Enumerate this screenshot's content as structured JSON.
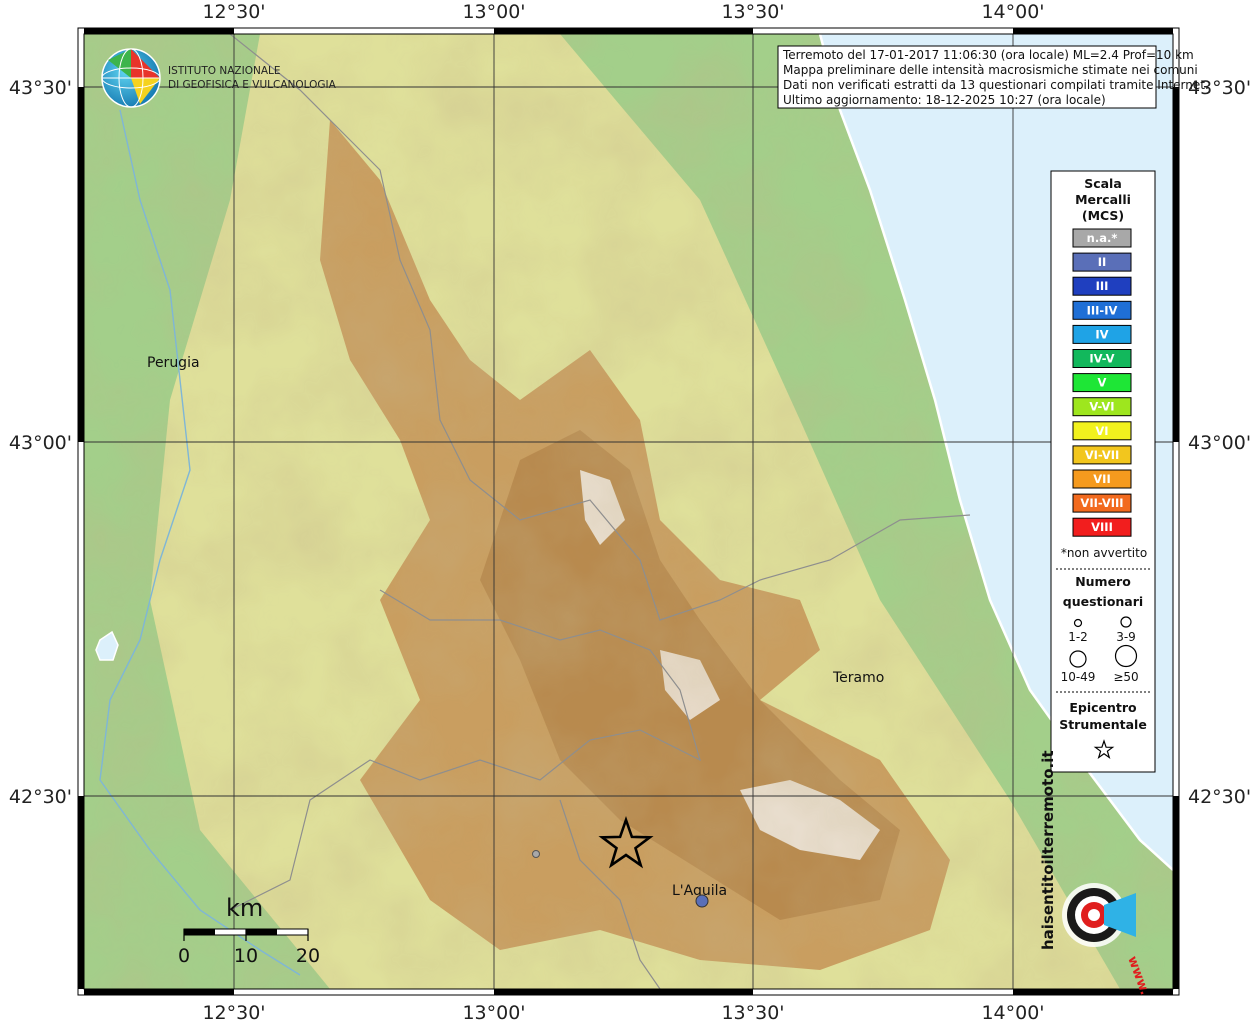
{
  "map": {
    "lon_ticks": [
      "12°30'",
      "13°00'",
      "13°30'",
      "14°00'"
    ],
    "lat_ticks": [
      "43°30'",
      "43°00'",
      "42°30'"
    ],
    "colors": {
      "sea": "#dcf0fb",
      "lowland": "#9fd08a",
      "hill": "#e6e098",
      "mountain": "#c79a5c",
      "peak": "#f4f0ec"
    }
  },
  "logo": {
    "line1": "ISTITUTO NAZIONALE",
    "line2": "DI GEOFISICA E VULCANOLOGIA",
    "icon": "ingv-globe-icon"
  },
  "info": {
    "lines": [
      "Terremoto del 17-01-2017 11:06:30 (ora locale) ML=2.4 Prof=10 km",
      "Mappa preliminare delle intensità macrosismiche stimate nei comuni",
      "Dati non verificati estratti da 13 questionari compilati tramite Internet.",
      "Ultimo aggiornamento: 18-12-2025 10:27 (ora locale)"
    ]
  },
  "cities": {
    "perugia": "Perugia",
    "teramo": "Teramo",
    "laquila": "L'Aquila"
  },
  "legend": {
    "title1": "Scala",
    "title2": "Mercalli",
    "title3": "(MCS)",
    "classes": [
      {
        "label": "n.a.*",
        "color": "#a8a8a8"
      },
      {
        "label": "II",
        "color": "#5a6fb8"
      },
      {
        "label": "III",
        "color": "#1f3fbf"
      },
      {
        "label": "III-IV",
        "color": "#1f6fd6"
      },
      {
        "label": "IV",
        "color": "#1fa3e6"
      },
      {
        "label": "IV-V",
        "color": "#12b85c"
      },
      {
        "label": "V",
        "color": "#1ee636"
      },
      {
        "label": "V-VI",
        "color": "#9ee61e"
      },
      {
        "label": "VI",
        "color": "#f2f21e"
      },
      {
        "label": "VI-VII",
        "color": "#f2c61e"
      },
      {
        "label": "VII",
        "color": "#f59a1e"
      },
      {
        "label": "VII-VIII",
        "color": "#f26a1e"
      },
      {
        "label": "VIII",
        "color": "#f21e1e"
      }
    ],
    "not_felt": "*non avvertito",
    "count_title1": "Numero",
    "count_title2": "questionari",
    "counts": [
      "1-2",
      "3-9",
      "10-49",
      "≥50"
    ],
    "epi1": "Epicentro",
    "epi2": "Strumentale"
  },
  "scale": {
    "unit": "km",
    "labels": [
      "0",
      "10",
      "20"
    ]
  },
  "brand": {
    "text": "haisentitoilterremoto.it",
    "url": "www."
  }
}
